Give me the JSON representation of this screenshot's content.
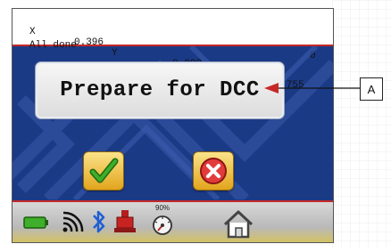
{
  "header": {
    "x_label": "X",
    "x_value": "0.396",
    "y_label": "Y",
    "y_value": "0.002",
    "z_label": "Z",
    "z_value": "-6.755",
    "status_text": "All done",
    "status_count": "0"
  },
  "message": {
    "text": "Prepare for DCC"
  },
  "buttons": {
    "ok_icon": "checkmark-icon",
    "cancel_icon": "x-circle-icon"
  },
  "toolbar": {
    "battery_icon": "battery-icon",
    "wifi_icon": "wifi-icon",
    "bluetooth_icon": "bluetooth-icon",
    "probe_icon": "probe-icon",
    "speed_percent": "90%",
    "speed_icon": "speedometer-icon",
    "home_icon": "home-icon"
  },
  "callout": {
    "label": "A"
  },
  "colors": {
    "screen_blue": "#1b3a86",
    "accent_red": "#c62828",
    "button_gold": "#e2a51c"
  }
}
